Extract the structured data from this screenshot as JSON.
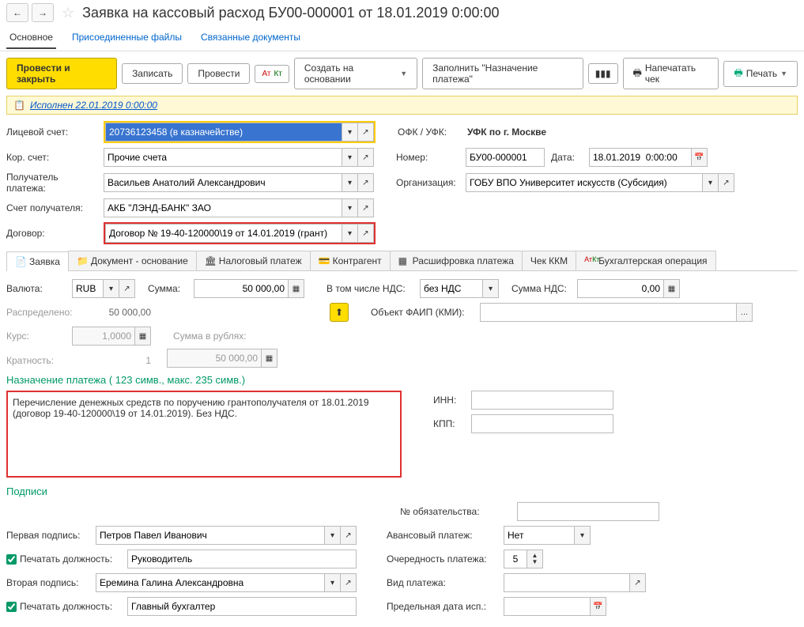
{
  "header": {
    "title": "Заявка на кассовый расход БУ00-000001 от 18.01.2019 0:00:00"
  },
  "top_tabs": {
    "main": "Основное",
    "files": "Присоединенные файлы",
    "related": "Связанные документы"
  },
  "buttons": {
    "post_close": "Провести и закрыть",
    "save": "Записать",
    "post": "Провести",
    "create_base": "Создать на основании",
    "fill_purpose": "Заполнить \"Назначение платежа\"",
    "print_check": "Напечатать чек",
    "print": "Печать"
  },
  "status": {
    "text": "Исполнен 22.01.2019 0:00:00"
  },
  "fields": {
    "personal_account_lbl": "Лицевой счет:",
    "personal_account": "20736123458 (в казначействе)",
    "ofk_lbl": "ОФК / УФК:",
    "ofk": "УФК по г. Москве",
    "corr_account_lbl": "Кор. счет:",
    "corr_account": "Прочие счета",
    "number_lbl": "Номер:",
    "number": "БУ00-000001",
    "date_lbl": "Дата:",
    "date": "18.01.2019  0:00:00",
    "payee_lbl": "Получатель платежа:",
    "payee": "Васильев Анатолий Александрович",
    "org_lbl": "Организация:",
    "org": "ГОБУ ВПО Университет искусств (Субсидия)",
    "payee_acc_lbl": "Счет получателя:",
    "payee_acc": "АКБ \"ЛЭНД-БАНК\" ЗАО",
    "contract_lbl": "Договор:",
    "contract": "Договор № 19-40-120000\\19 от 14.01.2019 (грант)"
  },
  "inner_tabs": {
    "t1": "Заявка",
    "t2": "Документ - основание",
    "t3": "Налоговый платеж",
    "t4": "Контрагент",
    "t5": "Расшифровка платежа",
    "t6": "Чек ККМ",
    "t7": "Бухгалтерская операция"
  },
  "app": {
    "currency_lbl": "Валюта:",
    "currency": "RUB",
    "sum_lbl": "Сумма:",
    "sum": "50 000,00",
    "vat_incl_lbl": "В том числе НДС:",
    "vat_incl": "без НДС",
    "vat_sum_lbl": "Сумма НДС:",
    "vat_sum": "0,00",
    "distributed_lbl": "Распределено:",
    "distributed": "50 000,00",
    "faip_lbl": "Объект ФАИП (КМИ):",
    "faip": "",
    "rate_lbl": "Курс:",
    "rate": "1,0000",
    "sum_rub_lbl": "Сумма в рублях:",
    "sum_rub": "50 000,00",
    "mult_lbl": "Кратность:",
    "mult": "1",
    "purpose_head": "Назначение платежа ( 123 симв., макс. 235 симв.)",
    "purpose_text": "Перечисление денежных средств по поручению грантополучателя от 18.01.2019 (договор 19-40-120000\\19 от 14.01.2019). Без НДС.",
    "inn_lbl": "ИНН:",
    "inn": "",
    "kpp_lbl": "КПП:",
    "kpp": "",
    "sign_head": "Подписи",
    "obl_lbl": "№ обязательства:",
    "obl": "",
    "sign1_lbl": "Первая подпись:",
    "sign1": "Петров Павел Иванович",
    "advance_lbl": "Авансовый платеж:",
    "advance": "Нет",
    "print_pos_lbl": "Печатать должность:",
    "pos1": "Руководитель",
    "order_lbl": "Очередность платежа:",
    "order": "5",
    "sign2_lbl": "Вторая подпись:",
    "sign2": "Еремина Галина Александровна",
    "paytype_lbl": "Вид платежа:",
    "paytype": "",
    "pos2": "Главный бухгалтер",
    "deadline_lbl": "Предельная дата исп.:",
    "deadline": ""
  }
}
